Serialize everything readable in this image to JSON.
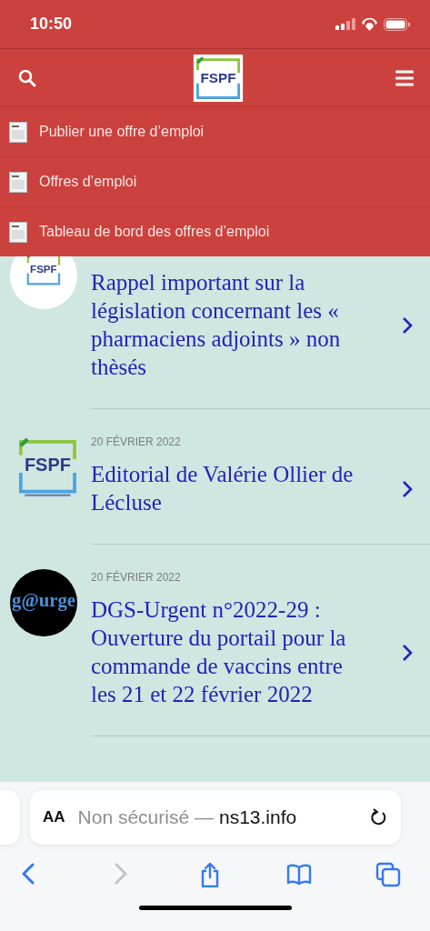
{
  "status_bar": {
    "time": "10:50"
  },
  "header": {
    "logo_text": "FSPF"
  },
  "menu": {
    "items": [
      {
        "label": "Publier une offre d’emploi"
      },
      {
        "label": "Offres d’emploi"
      },
      {
        "label": "Tableau de bord des offres d’emploi"
      }
    ]
  },
  "articles": [
    {
      "avatar": {
        "kind": "fspf-round",
        "text": "FSPF"
      },
      "title": "Rappel important sur la législation concernant les « pharmaciens adjoints » non thèsés"
    },
    {
      "avatar": {
        "kind": "fspf",
        "text": "FSPF"
      },
      "date": "20 FÉVRIER 2022",
      "title": "Editorial de Valérie Ollier de Lécluse"
    },
    {
      "avatar": {
        "kind": "dark-round",
        "text": "g@urge"
      },
      "date": "20 FÉVRIER 2022",
      "title": "DGS-Urgent n°2022-29 : Ouverture du portail pour la commande de vaccins entre les 21 et 22 février 2022"
    }
  ],
  "browser": {
    "text_size": "AA",
    "security_label": "Non sécurisé —",
    "domain": "ns13.info",
    "toolbar": [
      {
        "kind": "back",
        "disabled": false
      },
      {
        "kind": "forward",
        "disabled": true
      },
      {
        "kind": "share",
        "disabled": false
      },
      {
        "kind": "bookmarks",
        "disabled": false
      },
      {
        "kind": "tabs",
        "disabled": false
      }
    ]
  }
}
